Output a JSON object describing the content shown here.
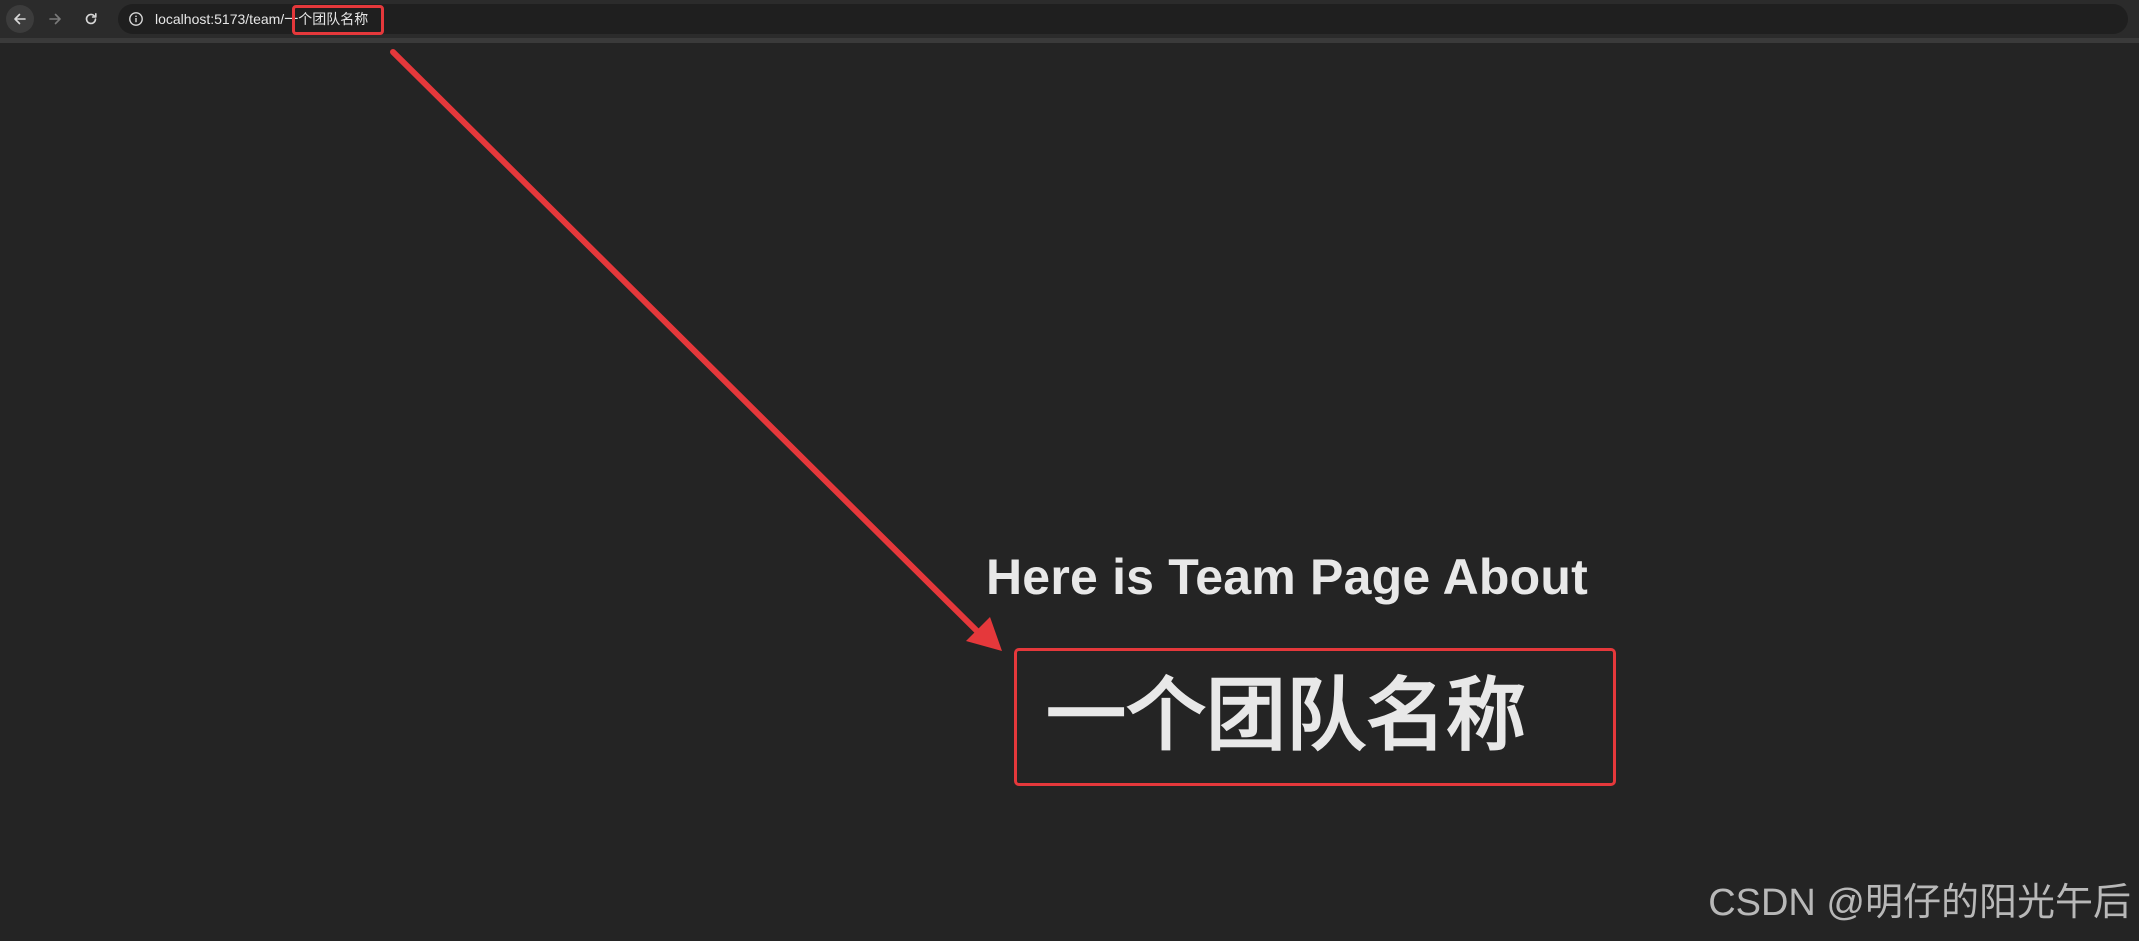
{
  "browser": {
    "url_host": "localhost:5173/team/",
    "url_param": "一个团队名称"
  },
  "page": {
    "heading": "Here is Team Page About",
    "team_name": "一个团队名称"
  },
  "watermark": {
    "text": "CSDN @明仔的阳光午后"
  },
  "colors": {
    "background": "#242424",
    "annotation_red": "#e5383b",
    "text": "#e8e8e8"
  },
  "icons": {
    "back": "arrow-left-icon",
    "forward": "arrow-right-icon",
    "reload": "reload-icon",
    "info": "info-icon"
  }
}
